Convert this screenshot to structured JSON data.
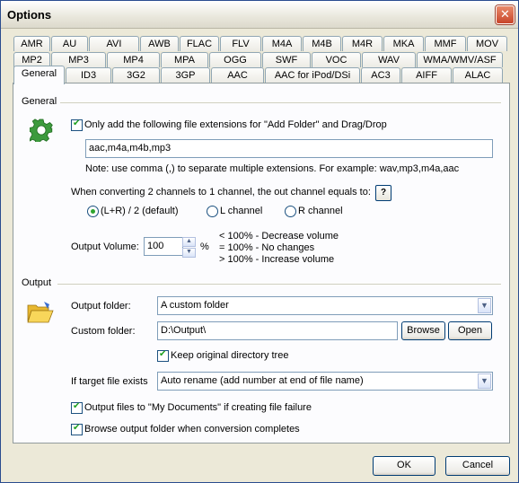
{
  "window": {
    "title": "Options",
    "close_glyph": "✕"
  },
  "tabs_row1": [
    "AMR",
    "AU",
    "AVI",
    "AWB",
    "FLAC",
    "FLV",
    "M4A",
    "M4B",
    "M4R",
    "MKA",
    "MMF",
    "MOV"
  ],
  "tabs_row2": [
    "MP2",
    "MP3",
    "MP4",
    "MPA",
    "OGG",
    "SWF",
    "VOC",
    "WAV",
    "WMA/WMV/ASF"
  ],
  "tabs_row3": [
    "General",
    "ID3",
    "3G2",
    "3GP",
    "AAC",
    "AAC for iPod/DSi",
    "AC3",
    "AIFF",
    "ALAC"
  ],
  "general": {
    "group_label": "General",
    "only_add_label": "Only add the following file extensions for \"Add Folder\" and Drag/Drop",
    "only_add_checked": true,
    "extensions_value": "aac,m4a,m4b,mp3",
    "note": "Note: use comma (,) to separate multiple extensions. For example: wav,mp3,m4a,aac",
    "channel_question": "When converting 2 channels to 1 channel, the out channel equals to:",
    "help_label": "?",
    "radio_lr": "(L+R) / 2 (default)",
    "radio_l": "L channel",
    "radio_r": "R channel",
    "selected_channel": "lr",
    "output_volume_label": "Output Volume:",
    "output_volume_value": "100",
    "percent": "%",
    "volume_hint1": "< 100% - Decrease volume",
    "volume_hint2": "= 100% - No changes",
    "volume_hint3": "> 100% - Increase volume"
  },
  "output": {
    "group_label": "Output",
    "folder_label": "Output folder:",
    "folder_value": "A custom folder",
    "custom_label": "Custom folder:",
    "custom_value": "D:\\Output\\",
    "browse_label": "Browse",
    "open_label": "Open",
    "keep_tree_label": "Keep original directory tree",
    "keep_tree_checked": true,
    "exists_label": "If target file exists",
    "exists_value": "Auto rename (add number at end of file name)",
    "mydocs_label": "Output files to \"My Documents\" if creating file failure",
    "mydocs_checked": true,
    "browse_folder_label": "Browse output folder when conversion completes",
    "browse_folder_checked": true
  },
  "footer": {
    "ok_label": "OK",
    "cancel_label": "Cancel"
  }
}
